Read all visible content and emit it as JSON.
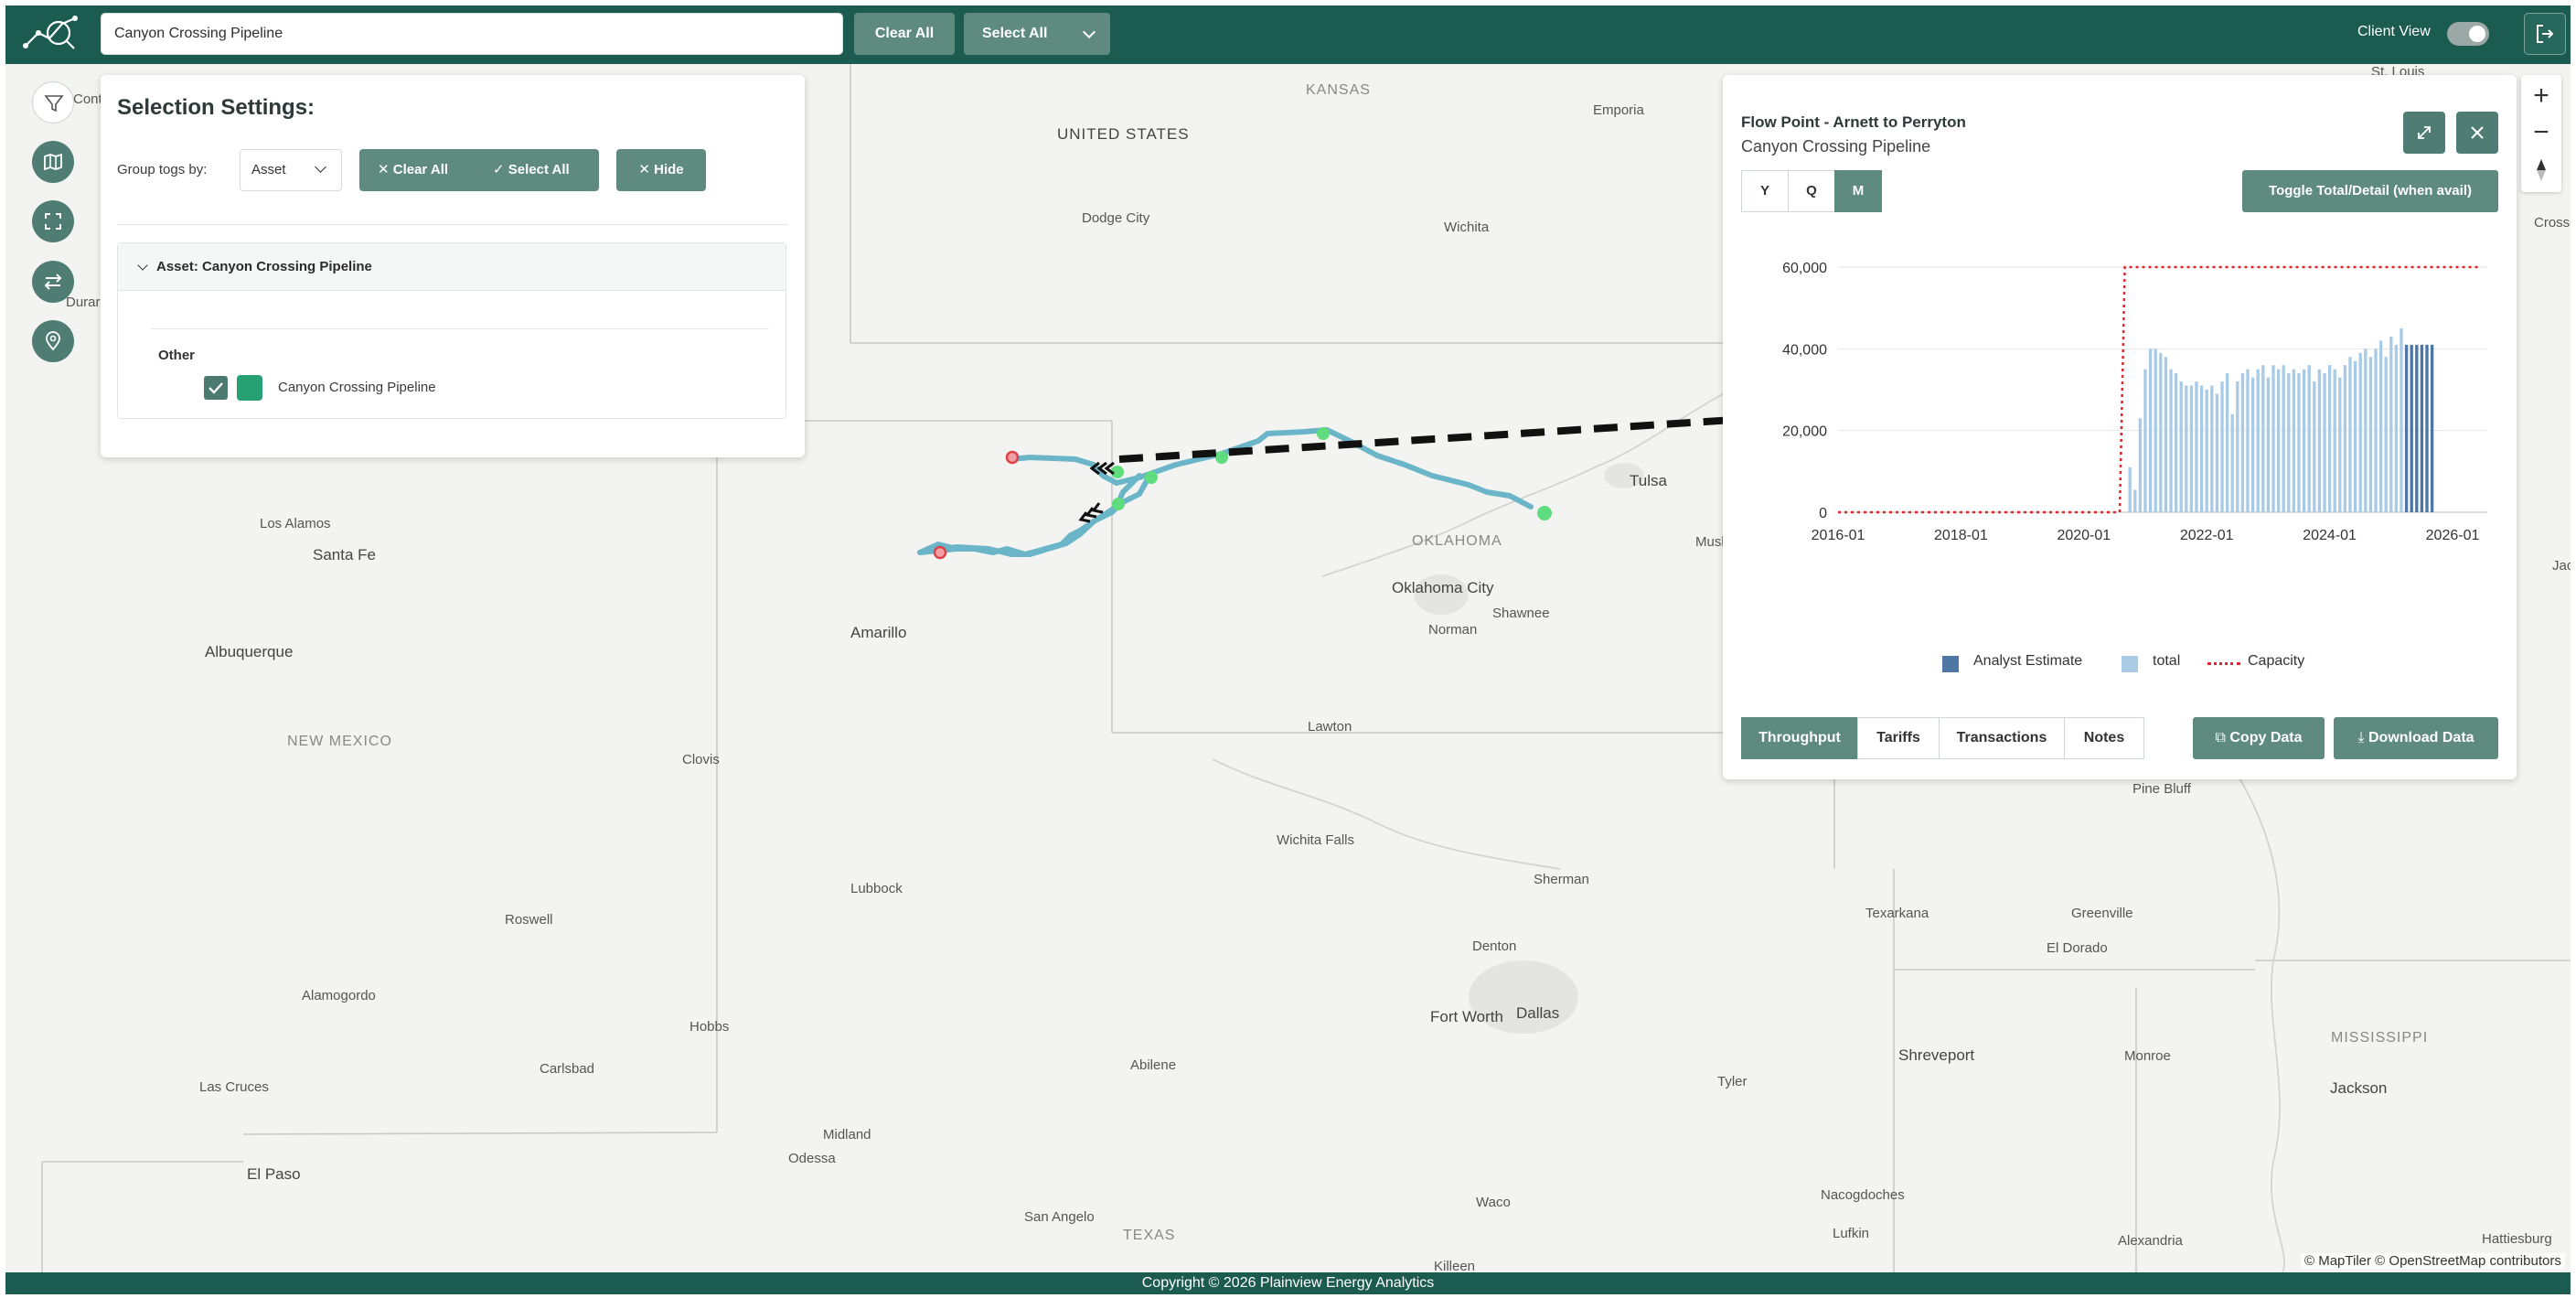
{
  "topbar": {
    "search_value": "Canyon Crossing Pipeline",
    "clear_all": "Clear All",
    "select_all": "Select All",
    "client_view": "Client View",
    "client_view_on": true
  },
  "map": {
    "states": [
      "KANSAS",
      "UNITED STATES",
      "OKLAHOMA",
      "NEW MEXICO",
      "TEXAS",
      "MISSISSIPPI"
    ],
    "cities": [
      "Emporia",
      "St. Louis",
      "Dodge City",
      "Wichita",
      "Tulsa",
      "Los Alamos",
      "Santa Fe",
      "Oklahoma City",
      "Shawnee",
      "Norman",
      "Amarillo",
      "Albuquerque",
      "Lawton",
      "Clovis",
      "Wichita Falls",
      "Pine Bluff",
      "Lubbock",
      "Sherman",
      "Texarkana",
      "Greenville",
      "Roswell",
      "Denton",
      "El Dorado",
      "Alamogordo",
      "Fort Worth",
      "Dallas",
      "Hobbs",
      "Carlsbad",
      "Shreveport",
      "Monroe",
      "Las Cruces",
      "Abilene",
      "Tyler",
      "Jackson",
      "Midland",
      "El Paso",
      "Odessa",
      "Waco",
      "Nacogdoches",
      "San Angelo",
      "Lufkin",
      "Alexandria",
      "Hattiesburg",
      "Killeen",
      "Musk",
      "Jac",
      "Durar",
      "Contr",
      "Crossette"
    ],
    "attribution": "© MapTiler © OpenStreetMap contributors",
    "logo_text": "maptiler",
    "colors": {
      "pipeline": "#6bb5c8",
      "node_green": "#5fdc7d",
      "endpoint_red": "#d9434a",
      "arrow": "#111111"
    }
  },
  "left_tools": [
    {
      "name": "filter-icon"
    },
    {
      "name": "map-icon"
    },
    {
      "name": "expand-icon"
    },
    {
      "name": "swap-icon"
    },
    {
      "name": "location-pin-icon"
    }
  ],
  "selection": {
    "title": "Selection Settings:",
    "group_label": "Group togs by:",
    "group_value": "Asset",
    "clear_all": "Clear All",
    "select_all": "Select All",
    "hide": "Hide",
    "asset_header": "Asset: Canyon Crossing Pipeline",
    "category": "Other",
    "item_label": "Canyon Crossing Pipeline",
    "item_checked": true,
    "item_color": "#27a073"
  },
  "flow": {
    "title": "Flow Point - Arnett to Perryton",
    "subtitle": "Canyon Crossing Pipeline",
    "periods": [
      "Y",
      "Q",
      "M"
    ],
    "active_period": "M",
    "toggle_total": "Toggle Total/Detail (when avail)",
    "tabs": [
      "Throughput",
      "Tariffs",
      "Transactions",
      "Notes"
    ],
    "active_tab": "Throughput",
    "copy_data": "Copy Data",
    "download_data": "Download Data"
  },
  "chart_data": {
    "type": "bar",
    "x_ticks": [
      "2016-01",
      "2018-01",
      "2020-01",
      "2022-01",
      "2024-01",
      "2026-01"
    ],
    "y_ticks": [
      "0",
      "20,000",
      "40,000",
      "60,000"
    ],
    "ylim": [
      0,
      60000
    ],
    "xlim": [
      "2016-01",
      "2026-06"
    ],
    "legend": [
      "Analyst Estimate",
      "total",
      "Capacity"
    ],
    "colors": {
      "analyst_estimate": "#4e77a6",
      "total": "#a9cbe6",
      "capacity": "#e0252b"
    },
    "series": [
      {
        "name": "total",
        "start": "2020-10",
        "values": [
          11000,
          5500,
          23000,
          35000,
          40000,
          40000,
          39000,
          38000,
          35000,
          34000,
          32000,
          31000,
          31000,
          32000,
          31000,
          30000,
          31000,
          29000,
          32000,
          34000,
          24000,
          32000,
          34000,
          35000,
          33000,
          35000,
          36000,
          33000,
          36000,
          35000,
          36000,
          34000,
          35000,
          34000,
          35000,
          36000,
          32000,
          35000,
          34000,
          36000,
          35000,
          33000,
          36000,
          38000,
          37000,
          39000,
          40000,
          38000,
          40000,
          42000,
          38000,
          43000,
          41000,
          45000
        ]
      },
      {
        "name": "Analyst Estimate",
        "start": "2025-04",
        "values": [
          41000,
          41000,
          41000,
          41000,
          41000,
          41000
        ]
      },
      {
        "name": "Capacity",
        "points": [
          [
            "2016-01",
            0
          ],
          [
            "2020-08",
            0
          ],
          [
            "2020-09",
            60000
          ],
          [
            "2026-06",
            60000
          ]
        ]
      }
    ]
  },
  "footer": "Copyright © 2026 Plainview Energy Analytics"
}
